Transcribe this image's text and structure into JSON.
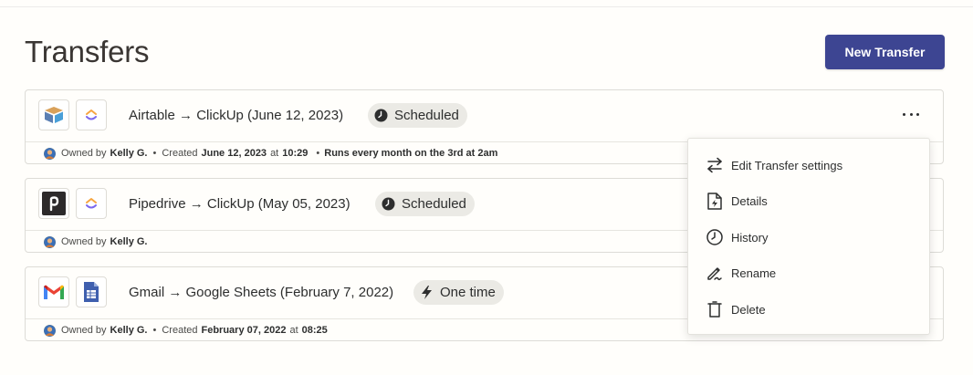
{
  "page": {
    "title": "Transfers",
    "new_button_label": "New Transfer"
  },
  "colors": {
    "primary": "#3d4592",
    "badge_bg": "#ebeae5",
    "text": "#2d2e2e"
  },
  "transfers": [
    {
      "title": "Airtable → ClickUp (June 12, 2023)",
      "source_icon": "airtable-icon",
      "dest_icon": "clickup-icon",
      "badge": "Scheduled",
      "badge_icon": "clock-icon",
      "owned_by_label": "Owned by",
      "owner": "Kelly G.",
      "created_label": "Created",
      "created_date": "June 12, 2023",
      "at_label": "at",
      "created_time": "10:29",
      "schedule": "Runs every month on the 3rd at 2am"
    },
    {
      "title": "Pipedrive → ClickUp (May 05, 2023)",
      "source_icon": "pipedrive-icon",
      "dest_icon": "clickup-icon",
      "badge": "Scheduled",
      "badge_icon": "clock-icon",
      "owned_by_label": "Owned by",
      "owner": "Kelly G."
    },
    {
      "title": "Gmail → Google Sheets (February 7, 2022)",
      "source_icon": "gmail-icon",
      "dest_icon": "google-sheets-icon",
      "badge": "One time",
      "badge_icon": "lightning-icon",
      "owned_by_label": "Owned by",
      "owner": "Kelly G.",
      "created_label": "Created",
      "created_date": "February 07, 2022",
      "at_label": "at",
      "created_time": "08:25"
    }
  ],
  "menu": {
    "items": [
      {
        "label": "Edit Transfer settings",
        "icon": "swap-arrows-icon"
      },
      {
        "label": "Details",
        "icon": "document-icon"
      },
      {
        "label": "History",
        "icon": "clock-icon"
      },
      {
        "label": "Rename",
        "icon": "pen-icon"
      },
      {
        "label": "Delete",
        "icon": "trash-icon"
      }
    ]
  }
}
